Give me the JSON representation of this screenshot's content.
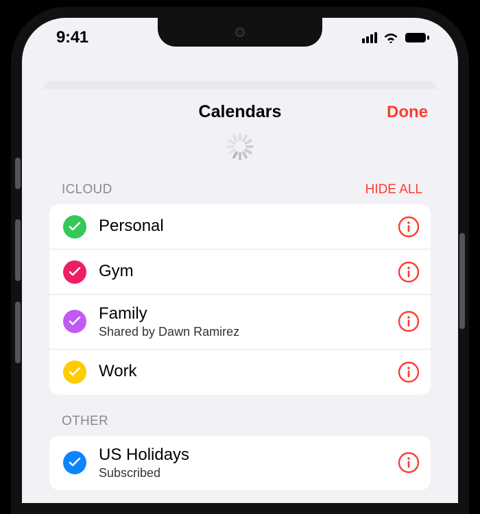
{
  "status": {
    "time": "9:41"
  },
  "sheet": {
    "title": "Calendars",
    "done": "Done"
  },
  "sections": {
    "icloud": {
      "label": "ICLOUD",
      "hide_all": "HIDE ALL",
      "items": [
        {
          "label": "Personal",
          "color": "#34c759"
        },
        {
          "label": "Gym",
          "color": "#ec1e64"
        },
        {
          "label": "Family",
          "sub": "Shared by Dawn Ramirez",
          "color": "#bf5af2"
        },
        {
          "label": "Work",
          "color": "#ffcc00"
        }
      ]
    },
    "other": {
      "label": "OTHER",
      "items": [
        {
          "label": "US Holidays",
          "sub": "Subscribed",
          "color": "#0a84ff"
        }
      ]
    }
  },
  "colors": {
    "accent": "#ff3b30"
  }
}
